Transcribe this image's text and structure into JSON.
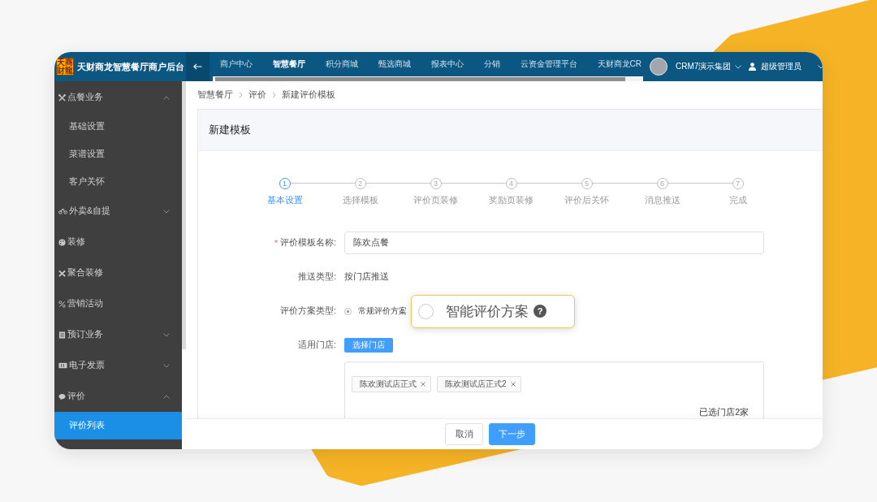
{
  "header": {
    "logo": [
      "天財",
      "商龍"
    ],
    "title": "天财商龙智慧餐厅商户后台",
    "nav": [
      {
        "label": "商户中心",
        "selected": false
      },
      {
        "label": "智慧餐厅",
        "selected": true
      },
      {
        "label": "积分商城",
        "selected": false
      },
      {
        "label": "甄选商城",
        "selected": false
      },
      {
        "label": "报表中心",
        "selected": false
      },
      {
        "label": "分销",
        "selected": false
      },
      {
        "label": "云资金管理平台",
        "selected": false
      },
      {
        "label": "天财商龙CR",
        "selected": false
      }
    ],
    "organization": "CRM7演示集团",
    "user": "超级管理员"
  },
  "sidebar": {
    "items": [
      {
        "label": "点餐业务",
        "kind": "group",
        "expanded": true,
        "children": [
          {
            "label": "基础设置",
            "selected": false
          },
          {
            "label": "菜谱设置",
            "selected": false
          },
          {
            "label": "客户关怀",
            "selected": false
          }
        ]
      },
      {
        "label": "外卖&自提",
        "kind": "group",
        "expanded": false
      },
      {
        "label": "装修",
        "kind": "link"
      },
      {
        "label": "聚合装修",
        "kind": "link"
      },
      {
        "label": "营销活动",
        "kind": "link"
      },
      {
        "label": "预订业务",
        "kind": "group",
        "expanded": false
      },
      {
        "label": "电子发票",
        "kind": "group",
        "expanded": false
      },
      {
        "label": "评价",
        "kind": "group",
        "expanded": true,
        "children": [
          {
            "label": "评价列表",
            "selected": true
          }
        ]
      }
    ]
  },
  "breadcrumb": [
    "智慧餐厅",
    "评价",
    "新建评价模板"
  ],
  "card": {
    "title": "新建模板",
    "steps": [
      {
        "number": "1",
        "label": "基本设置",
        "active": true
      },
      {
        "number": "2",
        "label": "选择模板",
        "active": false
      },
      {
        "number": "3",
        "label": "评价页装修",
        "active": false
      },
      {
        "number": "4",
        "label": "奖励页装修",
        "active": false
      },
      {
        "number": "5",
        "label": "评价后关怀",
        "active": false
      },
      {
        "number": "6",
        "label": "消息推送",
        "active": false
      },
      {
        "number": "7",
        "label": "完成",
        "active": false
      }
    ],
    "form": {
      "template_name": {
        "required_mark": "*",
        "label": "评价模板名称:",
        "value": "陈欢点餐"
      },
      "push_type": {
        "label": "推送类型:",
        "value": "按门店推送"
      },
      "plan_type": {
        "label": "评价方案类型:",
        "options": [
          {
            "label": "常规评价方案",
            "selected": true,
            "highlighted": false
          },
          {
            "label": "智能评价方案",
            "selected": false,
            "highlighted": true,
            "help_icon": "?"
          }
        ]
      },
      "stores": {
        "label": "适用门店:",
        "button": "选择门店",
        "tags": [
          "陈欢测试店正式",
          "陈欢测试店正式2"
        ],
        "summary": "已选门店2家"
      }
    }
  },
  "footer": {
    "buttons": [
      {
        "label": "取消",
        "kind": "default"
      },
      {
        "label": "下一步",
        "kind": "primary"
      }
    ]
  }
}
